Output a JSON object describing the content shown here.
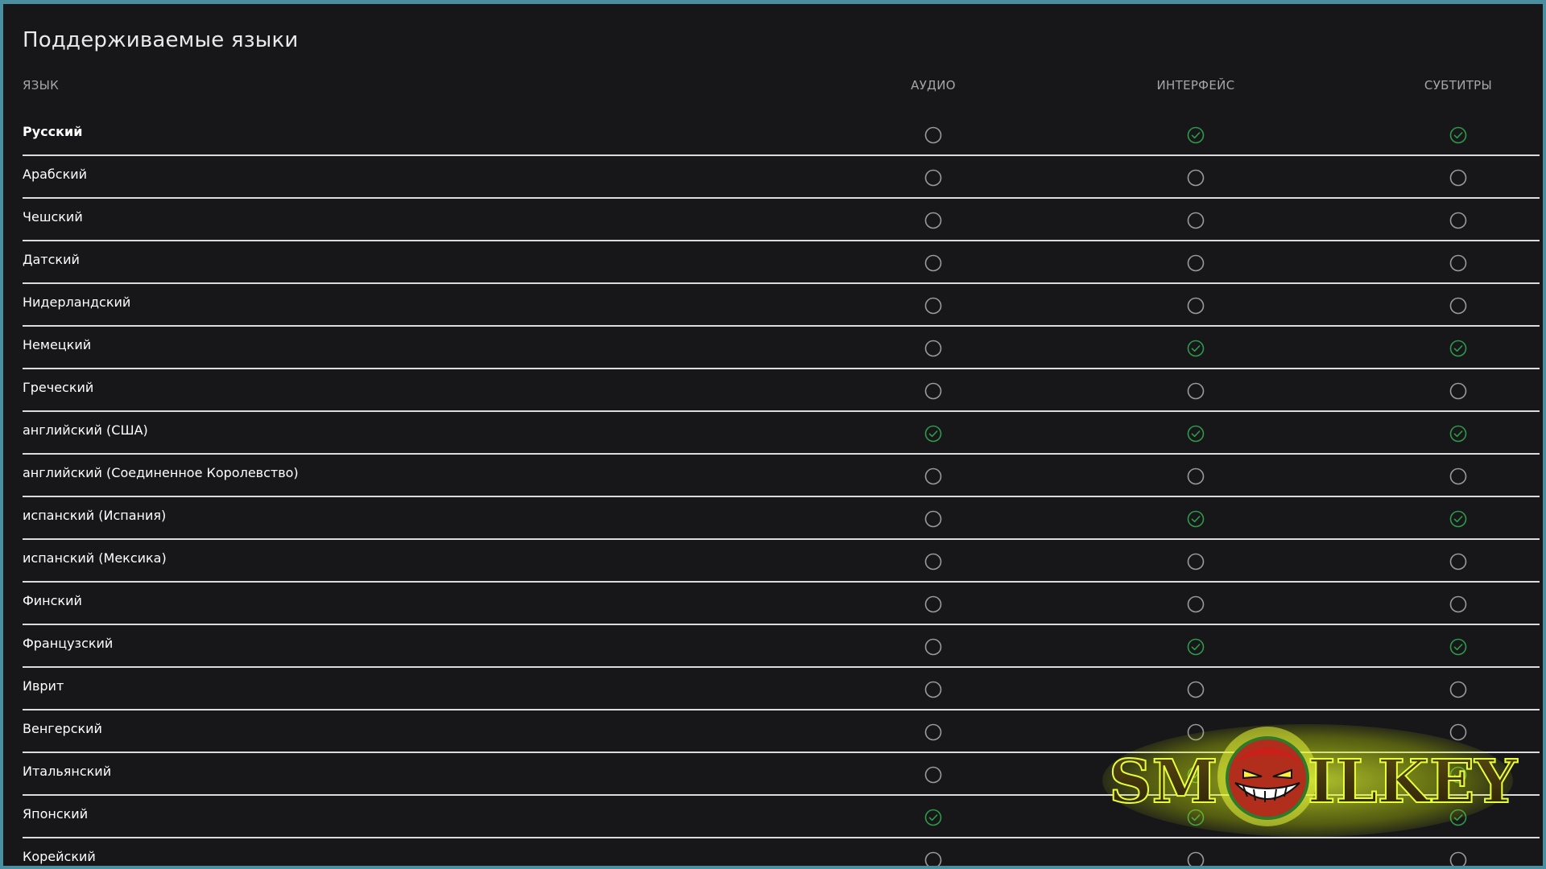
{
  "page": {
    "title": "Поддерживаемые языки"
  },
  "table": {
    "headers": {
      "language": "ЯЗЫК",
      "audio": "АУДИО",
      "interface": "ИНТЕРФЕЙС",
      "subtitles": "СУБТИТРЫ"
    },
    "rows": [
      {
        "name": "Русский",
        "audio": false,
        "interface": true,
        "subtitles": true
      },
      {
        "name": "Арабский",
        "audio": false,
        "interface": false,
        "subtitles": false
      },
      {
        "name": "Чешский",
        "audio": false,
        "interface": false,
        "subtitles": false
      },
      {
        "name": "Датский",
        "audio": false,
        "interface": false,
        "subtitles": false
      },
      {
        "name": "Нидерландский",
        "audio": false,
        "interface": false,
        "subtitles": false
      },
      {
        "name": "Немецкий",
        "audio": false,
        "interface": true,
        "subtitles": true
      },
      {
        "name": "Греческий",
        "audio": false,
        "interface": false,
        "subtitles": false
      },
      {
        "name": "английский (США)",
        "audio": true,
        "interface": true,
        "subtitles": true
      },
      {
        "name": "английский (Соединенное Королевство)",
        "audio": false,
        "interface": false,
        "subtitles": false
      },
      {
        "name": "испанский (Испания)",
        "audio": false,
        "interface": true,
        "subtitles": true
      },
      {
        "name": "испанский (Мексика)",
        "audio": false,
        "interface": false,
        "subtitles": false
      },
      {
        "name": "Финский",
        "audio": false,
        "interface": false,
        "subtitles": false
      },
      {
        "name": "Французский",
        "audio": false,
        "interface": true,
        "subtitles": true
      },
      {
        "name": "Иврит",
        "audio": false,
        "interface": false,
        "subtitles": false
      },
      {
        "name": "Венгерский",
        "audio": false,
        "interface": false,
        "subtitles": false
      },
      {
        "name": "Итальянский",
        "audio": false,
        "interface": true,
        "subtitles": true
      },
      {
        "name": "Японский",
        "audio": true,
        "interface": true,
        "subtitles": true
      },
      {
        "name": "Корейский",
        "audio": false,
        "interface": false,
        "subtitles": false
      }
    ]
  },
  "icons": {
    "supported": "check-circle-icon",
    "unsupported": "empty-circle-icon"
  },
  "colors": {
    "background": "#17171a",
    "check_green": "#2e9a4a",
    "circle_gray": "#9a9a9a",
    "divider": "#dcdcdc"
  },
  "watermark": {
    "text": "SMOILKEY"
  }
}
